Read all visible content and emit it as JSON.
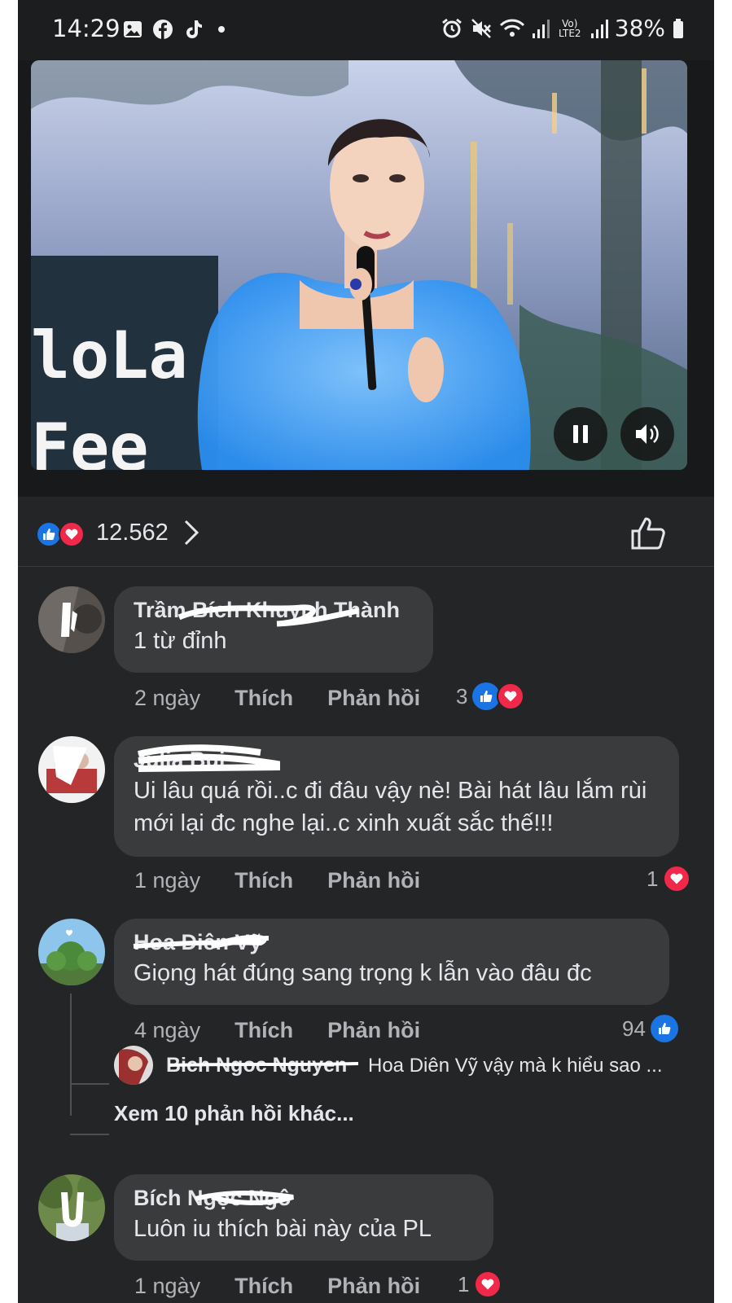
{
  "status_bar": {
    "time": "14:29",
    "battery": "38%",
    "network": "Vo) LTE2",
    "left_icons": [
      "gallery-icon",
      "facebook-icon",
      "tiktok-icon",
      "dot-icon"
    ],
    "right_icons": [
      "alarm-icon",
      "mute-icon",
      "wifi-icon",
      "signal-icon",
      "volte-icon",
      "signal-icon",
      "battery-icon"
    ]
  },
  "video": {
    "overlay_text_line1": "loLa",
    "overlay_text_line2": "Fee",
    "controls": [
      "pause-icon",
      "volume-icon"
    ]
  },
  "reactions": {
    "count": "12.562",
    "icons": [
      "like-icon",
      "love-icon"
    ]
  },
  "comments": [
    {
      "name": "Trầm Bích Khuynh Thành",
      "text": "1 từ đỉnh",
      "time": "2 ngày",
      "like_label": "Thích",
      "reply_label": "Phản hồi",
      "reaction_count": "3",
      "reactions": [
        "like-icon",
        "love-icon"
      ]
    },
    {
      "name": "Julia Bui",
      "text": "Ui lâu quá rồi..c đi đâu vậy nè! Bài hát lâu lắm rùi mới lại đc nghe lại..c xinh xuất sắc thế!!!",
      "time": "1 ngày",
      "like_label": "Thích",
      "reply_label": "Phản hồi",
      "reaction_count": "1",
      "reactions": [
        "love-icon"
      ]
    },
    {
      "name": "Hoa Diên Vỹ",
      "text": "Giọng hát đúng sang trọng k lẫn vào đâu đc",
      "time": "4 ngày",
      "like_label": "Thích",
      "reply_label": "Phản hồi",
      "reaction_count": "94",
      "reactions": [
        "like-icon"
      ],
      "reply": {
        "name": "Bich Ngoc Nguyen",
        "text": "Hoa Diên Vỹ vậy mà k hiểu sao ..."
      },
      "more_replies": "Xem 10 phản hồi khác..."
    },
    {
      "name": "Bích Ngọc Ngô",
      "text": "Luôn iu thích bài này của PL",
      "time": "1 ngày",
      "like_label": "Thích",
      "reply_label": "Phản hồi",
      "reaction_count": "1",
      "reactions": [
        "love-icon"
      ]
    }
  ],
  "colors": {
    "background": "#242526",
    "bubble": "#3a3b3c",
    "like_blue": "#1b74e4",
    "love_red": "#f02849",
    "secondary_text": "#b0b3b8"
  }
}
